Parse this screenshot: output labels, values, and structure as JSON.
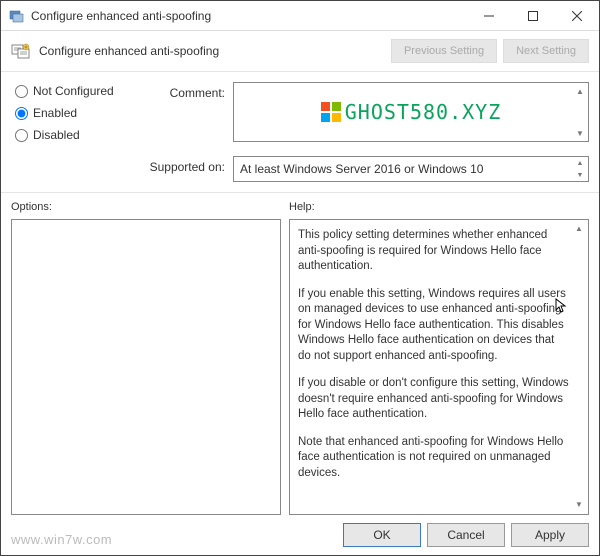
{
  "window": {
    "title": "Configure enhanced anti-spoofing"
  },
  "header": {
    "title": "Configure enhanced anti-spoofing",
    "prev": "Previous Setting",
    "next": "Next Setting"
  },
  "state": {
    "not_configured": "Not Configured",
    "enabled": "Enabled",
    "disabled": "Disabled",
    "selected": "enabled"
  },
  "labels": {
    "comment": "Comment:",
    "supported": "Supported on:",
    "options": "Options:",
    "help": "Help:"
  },
  "supported_text": "At least Windows Server 2016 or Windows 10",
  "watermarks": {
    "comment_box": "GHOST580.XYZ",
    "footer": "www.win7w.com"
  },
  "help": {
    "p1": "This policy setting determines whether enhanced anti-spoofing is required for Windows Hello face authentication.",
    "p2": "If you enable this setting, Windows requires all users on managed devices to use enhanced anti-spoofing for Windows Hello face authentication. This disables Windows Hello face authentication on devices that do not support enhanced anti-spoofing.",
    "p3": "If you disable or don't configure this setting, Windows doesn't require enhanced anti-spoofing for Windows Hello face authentication.",
    "p4": "Note that enhanced anti-spoofing for Windows Hello face authentication is not required on unmanaged devices."
  },
  "footer": {
    "ok": "OK",
    "cancel": "Cancel",
    "apply": "Apply"
  },
  "colors": {
    "logo": [
      "#f25022",
      "#7fba00",
      "#00a4ef",
      "#ffb900"
    ],
    "accent": "#3a7abf"
  }
}
